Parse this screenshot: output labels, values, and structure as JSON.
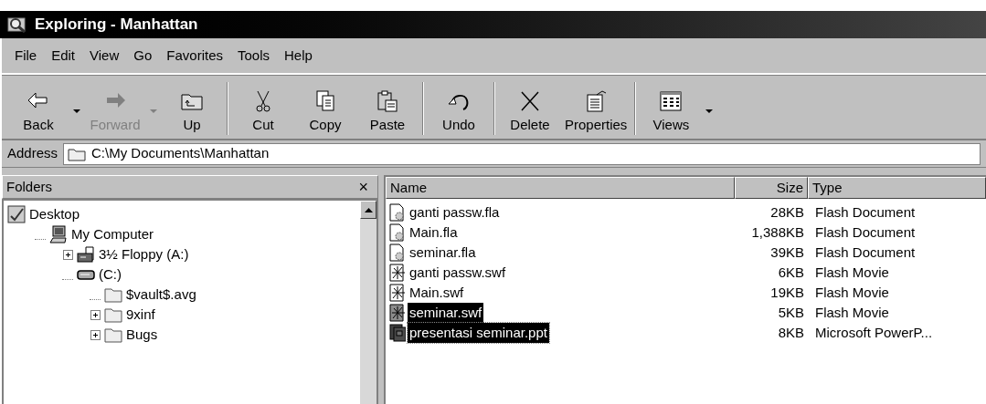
{
  "window": {
    "title": "Exploring - Manhattan"
  },
  "menu": [
    {
      "label": "File"
    },
    {
      "label": "Edit"
    },
    {
      "label": "View"
    },
    {
      "label": "Go"
    },
    {
      "label": "Favorites"
    },
    {
      "label": "Tools"
    },
    {
      "label": "Help"
    }
  ],
  "toolbar": [
    {
      "kind": "back",
      "label": "Back",
      "disabled": false,
      "dropdown": true
    },
    {
      "kind": "forward",
      "label": "Forward",
      "disabled": true,
      "dropdown": true
    },
    {
      "kind": "up",
      "label": "Up",
      "disabled": false,
      "dropdown": false
    },
    {
      "kind": "separator"
    },
    {
      "kind": "cut",
      "label": "Cut",
      "disabled": false,
      "dropdown": false
    },
    {
      "kind": "copy",
      "label": "Copy",
      "disabled": false,
      "dropdown": false
    },
    {
      "kind": "paste",
      "label": "Paste",
      "disabled": false,
      "dropdown": false
    },
    {
      "kind": "separator"
    },
    {
      "kind": "undo",
      "label": "Undo",
      "disabled": false,
      "dropdown": false
    },
    {
      "kind": "separator"
    },
    {
      "kind": "delete",
      "label": "Delete",
      "disabled": false,
      "dropdown": false
    },
    {
      "kind": "properties",
      "label": "Properties",
      "disabled": false,
      "dropdown": false
    },
    {
      "kind": "separator"
    },
    {
      "kind": "views",
      "label": "Views",
      "disabled": false,
      "dropdown": true
    }
  ],
  "address": {
    "label": "Address",
    "value": "C:\\My Documents\\Manhattan"
  },
  "folders": {
    "title": "Folders",
    "close": "×",
    "tree": [
      {
        "label": "Desktop",
        "kind": "desktop",
        "expandable": false,
        "children": [
          {
            "label": "My Computer",
            "kind": "computer",
            "expandable": false,
            "children": [
              {
                "label": "3½ Floppy (A:)",
                "kind": "floppy",
                "expandable": true
              },
              {
                "label": "(C:)",
                "kind": "drive",
                "expandable": false,
                "children": [
                  {
                    "label": "$vault$.avg",
                    "kind": "folder",
                    "expandable": false
                  },
                  {
                    "label": "9xinf",
                    "kind": "folder",
                    "expandable": true
                  },
                  {
                    "label": "Bugs",
                    "kind": "folder",
                    "expandable": true
                  }
                ]
              }
            ]
          }
        ]
      }
    ]
  },
  "files": {
    "columns": [
      "Name",
      "Size",
      "Type"
    ],
    "rows": [
      {
        "name": "ganti passw.fla",
        "size": "28KB",
        "type": "Flash Document",
        "kind": "fla",
        "selected": false,
        "focused": false
      },
      {
        "name": "Main.fla",
        "size": "1,388KB",
        "type": "Flash Document",
        "kind": "fla",
        "selected": false,
        "focused": false
      },
      {
        "name": "seminar.fla",
        "size": "39KB",
        "type": "Flash Document",
        "kind": "fla",
        "selected": false,
        "focused": false
      },
      {
        "name": "ganti passw.swf",
        "size": "6KB",
        "type": "Flash Movie",
        "kind": "swf",
        "selected": false,
        "focused": false
      },
      {
        "name": "Main.swf",
        "size": "19KB",
        "type": "Flash Movie",
        "kind": "swf",
        "selected": false,
        "focused": false
      },
      {
        "name": "seminar.swf",
        "size": "5KB",
        "type": "Flash Movie",
        "kind": "swf",
        "selected": true,
        "focused": false
      },
      {
        "name": "presentasi seminar.ppt",
        "size": "8KB",
        "type": "Microsoft PowerP...",
        "kind": "ppt",
        "selected": true,
        "focused": true
      }
    ]
  }
}
